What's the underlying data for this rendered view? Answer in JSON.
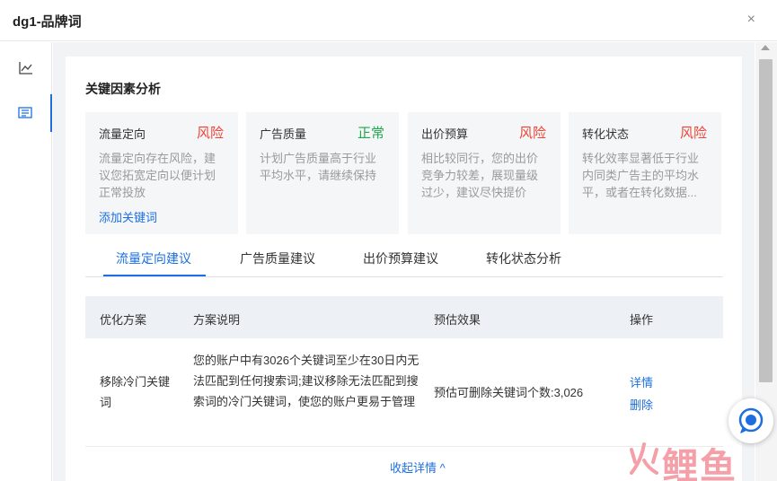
{
  "window": {
    "title": "dg1-品牌词",
    "close_glyph": "×"
  },
  "nav": {
    "items": [
      {
        "icon": "line-chart-icon",
        "active": false
      },
      {
        "icon": "report-icon",
        "active": true
      }
    ]
  },
  "section": {
    "title": "关键因素分析"
  },
  "factors": [
    {
      "name": "流量定向",
      "status": "风险",
      "status_color": "#f04134",
      "desc": "流量定向存在风险，建议您拓宽定向以便计划正常投放",
      "link": "添加关键词"
    },
    {
      "name": "广告质量",
      "status": "正常",
      "status_color": "#20a84c",
      "desc": "计划广告质量高于行业平均水平，请继续保持"
    },
    {
      "name": "出价预算",
      "status": "风险",
      "status_color": "#f04134",
      "desc": "相比较同行，您的出价竞争力较差，展现量级过少，建议尽快提价"
    },
    {
      "name": "转化状态",
      "status": "风险",
      "status_color": "#f04134",
      "desc": "转化效率显著低于行业内同类广告主的平均水平，或者在转化数据..."
    }
  ],
  "tabs": [
    {
      "label": "流量定向建议",
      "active": true
    },
    {
      "label": "广告质量建议",
      "active": false
    },
    {
      "label": "出价预算建议",
      "active": false
    },
    {
      "label": "转化状态分析",
      "active": false
    }
  ],
  "table": {
    "headers": {
      "plan": "优化方案",
      "desc": "方案说明",
      "effect": "预估效果",
      "action": "操作"
    },
    "rows": [
      {
        "plan": "移除冷门关键词",
        "desc": "您的账户中有3026个关键词至少在30日内无法匹配到任何搜索词;建议移除无法匹配到搜索词的冷门关键词，使您的账户更易于管理",
        "effect": "预估可删除关键词个数:3,026",
        "actions": [
          "详情",
          "删除"
        ]
      }
    ]
  },
  "collapse_label": "收起详情 ^",
  "chat": {
    "icon": "chat-bubble-icon"
  },
  "watermark": {
    "text": "鲤鱼"
  },
  "colors": {
    "accent": "#1d6fe0",
    "risk": "#f04134",
    "ok": "#20a84c"
  }
}
